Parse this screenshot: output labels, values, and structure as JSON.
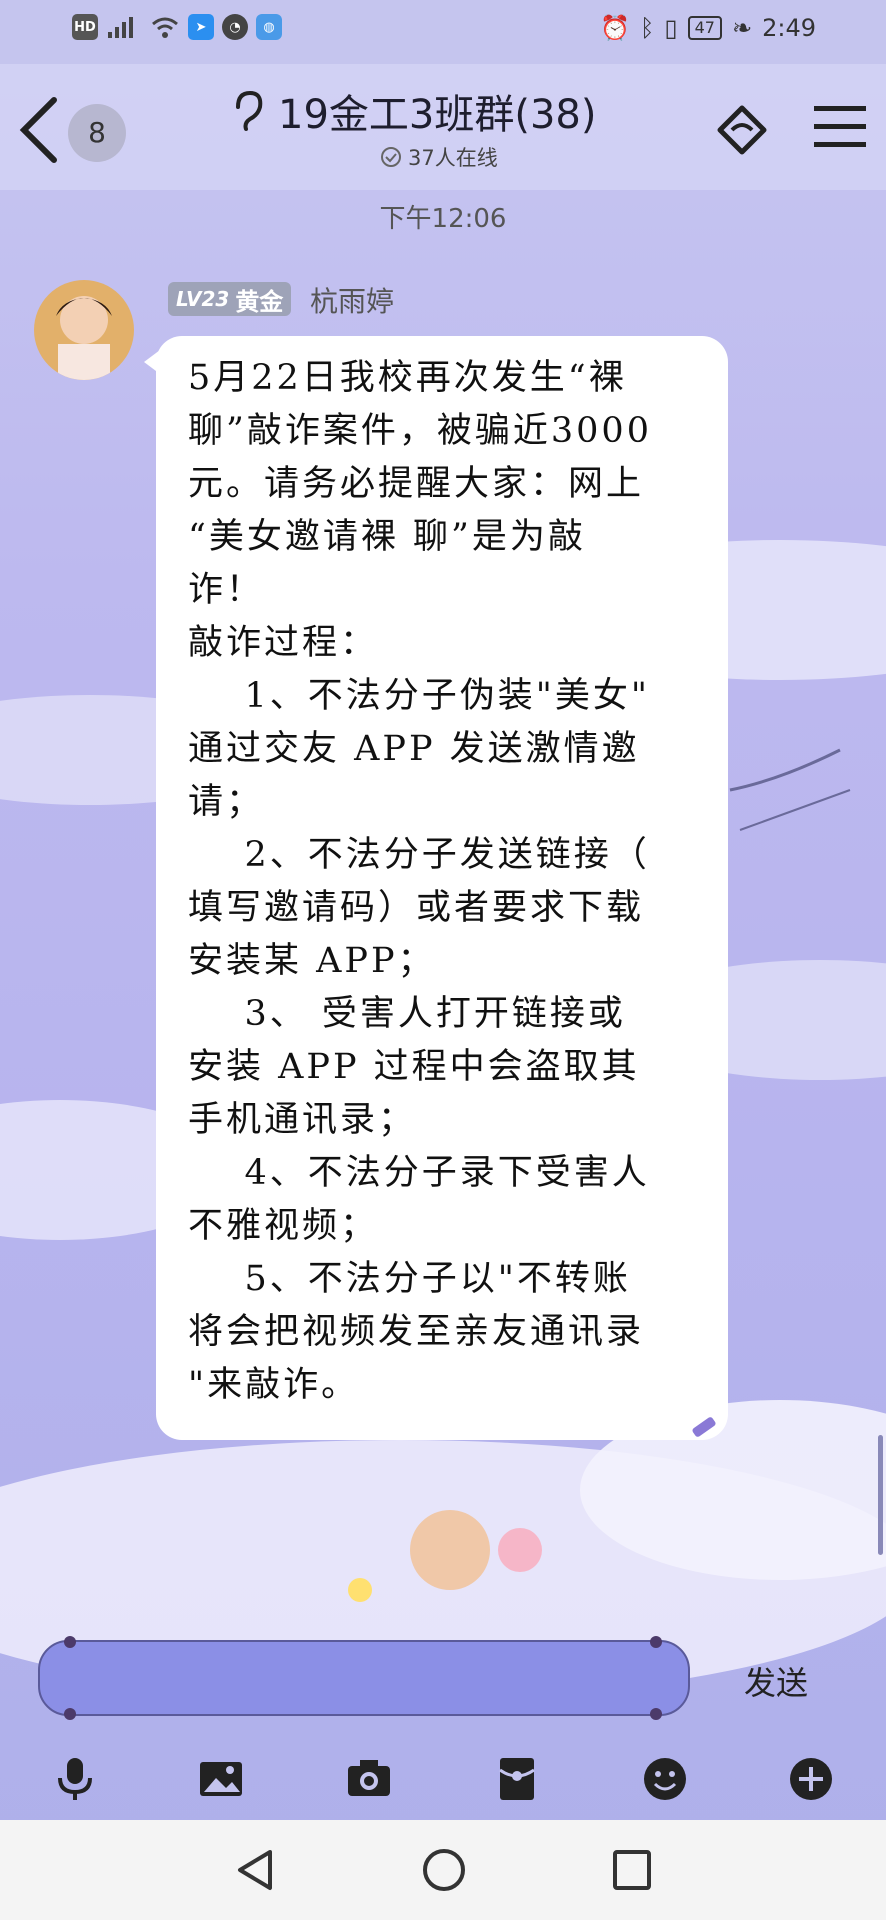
{
  "status_bar": {
    "left_icons": [
      "hd-icon",
      "4g-signal-icon",
      "wifi-icon",
      "app-notification-icon",
      "alarm-app-icon",
      "browser-icon"
    ],
    "hd_label": "HD",
    "battery": "47",
    "time": "2:49"
  },
  "header": {
    "unread_count": "8",
    "title": "19金工3班群(38)",
    "online": "37人在线"
  },
  "chat": {
    "timestamp": "下午12:06",
    "message": {
      "level": "LV23",
      "tier": "黄金",
      "sender": "杭雨婷",
      "text": "5月22日我校再次发生“裸\n聊”敲诈案件，被骗近3000\n元。请务必提醒大家：网上\n“美女邀请裸 聊”是为敲\n诈！\n敲诈过程：\n    1、不法分子伪装\"美女\"\n通过交友 APP 发送激情邀\n请；\n    2、不法分子发送链接（\n填写邀请码）或者要求下载\n安装某 APP；\n    3、 受害人打开链接或\n安装 APP 过程中会盗取其\n手机通讯录；\n    4、不法分子录下受害人\n不雅视频；\n    5、不法分子以\"不转账\n将会把视频发至亲友通讯录\n\"来敲诈。"
    }
  },
  "input": {
    "send_label": "发送"
  },
  "toolbar": [
    "microphone-icon",
    "image-icon",
    "camera-icon",
    "red-packet-icon",
    "emoji-icon",
    "plus-icon"
  ],
  "colors": {
    "background": "#bdb9ef",
    "input_fill": "#8b8fe6",
    "bubble": "#ffffff"
  }
}
